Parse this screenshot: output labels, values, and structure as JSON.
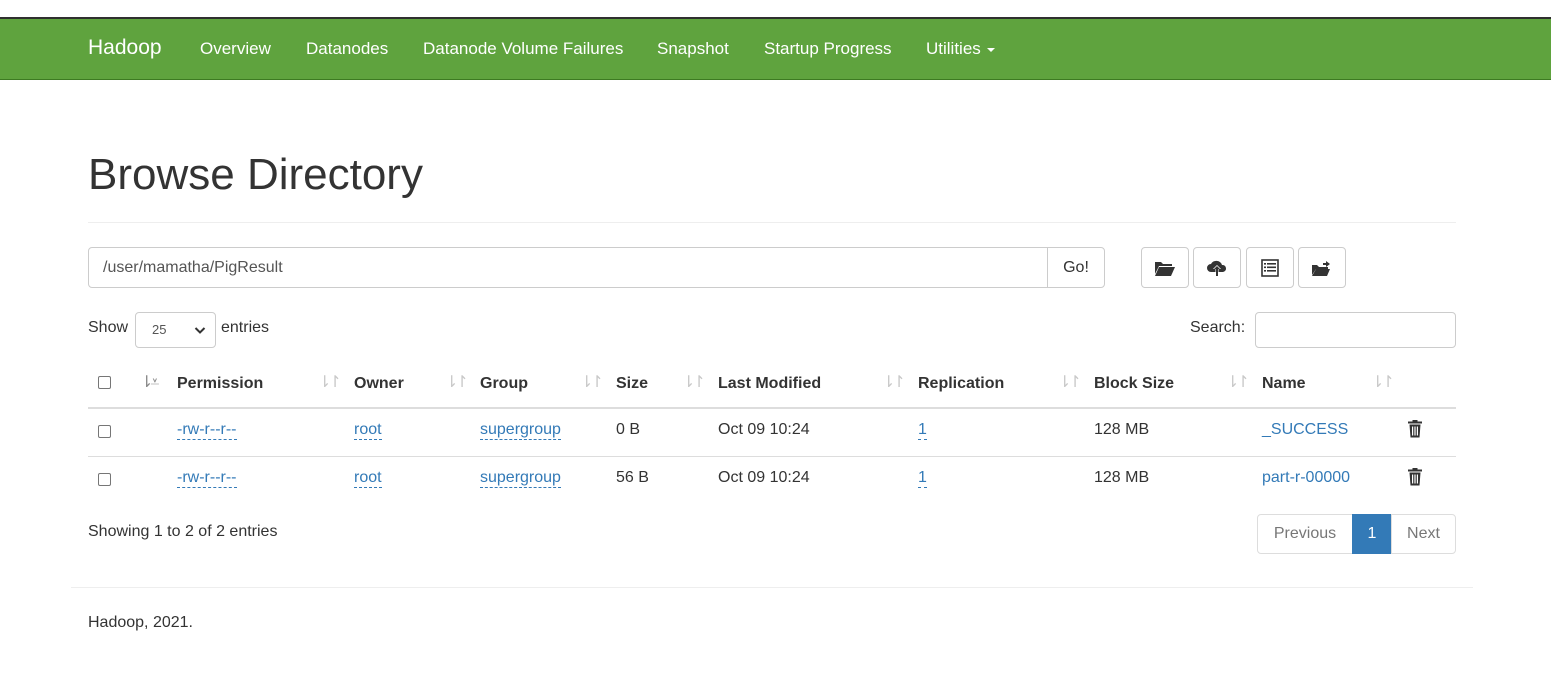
{
  "navbar": {
    "brand": "Hadoop",
    "items": [
      "Overview",
      "Datanodes",
      "Datanode Volume Failures",
      "Snapshot",
      "Startup Progress",
      "Utilities"
    ],
    "color": "#5fa33e"
  },
  "page": {
    "title": "Browse Directory"
  },
  "path_bar": {
    "value": "/user/mamatha/PigResult",
    "go_label": "Go!",
    "icons": [
      "folder-open-icon",
      "cloud-upload-icon",
      "list-alt-icon",
      "folder-move-icon"
    ]
  },
  "table_controls": {
    "show_label": "Show",
    "entries_value": "25",
    "entries_label": "entries",
    "search_label": "Search:"
  },
  "table": {
    "columns": [
      "Permission",
      "Owner",
      "Group",
      "Size",
      "Last Modified",
      "Replication",
      "Block Size",
      "Name"
    ],
    "rows": [
      {
        "permission": "-rw-r--r--",
        "owner": "root",
        "group": "supergroup",
        "size": "0 B",
        "modified": "Oct 09 10:24",
        "replication": "1",
        "block_size": "128 MB",
        "name": "_SUCCESS"
      },
      {
        "permission": "-rw-r--r--",
        "owner": "root",
        "group": "supergroup",
        "size": "56 B",
        "modified": "Oct 09 10:24",
        "replication": "1",
        "block_size": "128 MB",
        "name": "part-r-00000"
      }
    ]
  },
  "pagination": {
    "info": "Showing 1 to 2 of 2 entries",
    "previous": "Previous",
    "current": "1",
    "next": "Next"
  },
  "footer": {
    "text": "Hadoop, 2021."
  },
  "colors": {
    "link": "#337ab7",
    "active_page": "#337ab7"
  }
}
